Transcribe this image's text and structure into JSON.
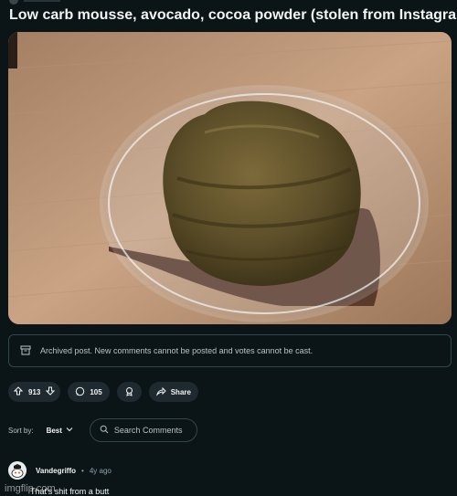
{
  "post": {
    "title": "Low carb mousse, avocado, cocoa powder (stolen from Instagram)"
  },
  "archived_notice": "Archived post. New comments cannot be posted and votes cannot be cast.",
  "actions": {
    "votes": "913",
    "comments": "105",
    "share_label": "Share"
  },
  "sort": {
    "label": "Sort by:",
    "selected": "Best",
    "search_placeholder": "Search Comments"
  },
  "comment": {
    "username": "Vandegriffo",
    "separator": "•",
    "age": "4y ago",
    "text": "That's shit from a butt"
  },
  "watermark": "imgflip.com",
  "icons": [
    "upvote-icon",
    "downvote-icon",
    "comment-icon",
    "award-icon",
    "share-icon",
    "search-icon",
    "chevron-down-icon",
    "archive-icon"
  ],
  "colors": {
    "background": "#0b1416",
    "pill": "#1e2a2f",
    "border": "#33464c",
    "muted_text": "#b7c4c9"
  }
}
